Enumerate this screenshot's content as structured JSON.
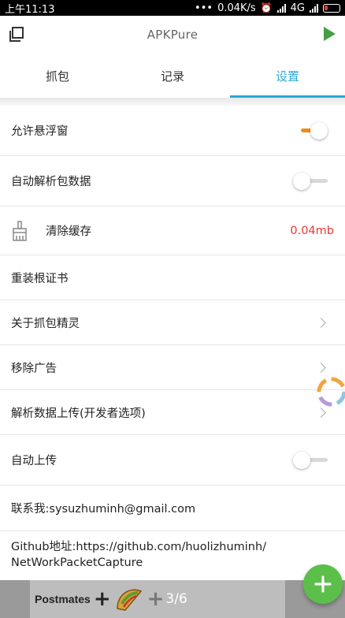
{
  "status_bar": {
    "time": "上午11:13",
    "dots": "•••",
    "speed": "0.04K/s",
    "network": "4G"
  },
  "app_bar": {
    "title": "APKPure",
    "copy_icon": "copy-icon",
    "play_icon": "play-icon",
    "play_color": "#43a047"
  },
  "tabs": [
    {
      "label": "抓包",
      "active": false
    },
    {
      "label": "记录",
      "active": false
    },
    {
      "label": "设置",
      "active": true
    }
  ],
  "accent_color": "#29a8d8",
  "settings": {
    "floating_window": {
      "label": "允许悬浮窗",
      "enabled": true
    },
    "auto_parse": {
      "label": "自动解析包数据",
      "enabled": false
    },
    "clear_cache": {
      "label": "清除缓存",
      "value": "0.04mb",
      "icon": "broom-icon"
    },
    "reinstall_cert": {
      "label": "重装根证书"
    },
    "about": {
      "label": "关于抓包精灵"
    },
    "remove_ads": {
      "label": "移除广告"
    },
    "upload_parsed": {
      "label": "解析数据上传(开发者选项)"
    },
    "auto_upload": {
      "label": "自动上传",
      "enabled": false
    },
    "contact": {
      "label": "联系我:sysuzhuminh@gmail.com"
    },
    "github": {
      "line1": "Github地址:https://github.com/huolizhuminh/",
      "line2": "NetWorkPacketCapture"
    }
  },
  "ad_banner": {
    "brand": "Postmates",
    "plus": "+",
    "pager": "3/6"
  },
  "fab": {
    "icon": "plus-icon",
    "color": "#5cbf4a"
  }
}
